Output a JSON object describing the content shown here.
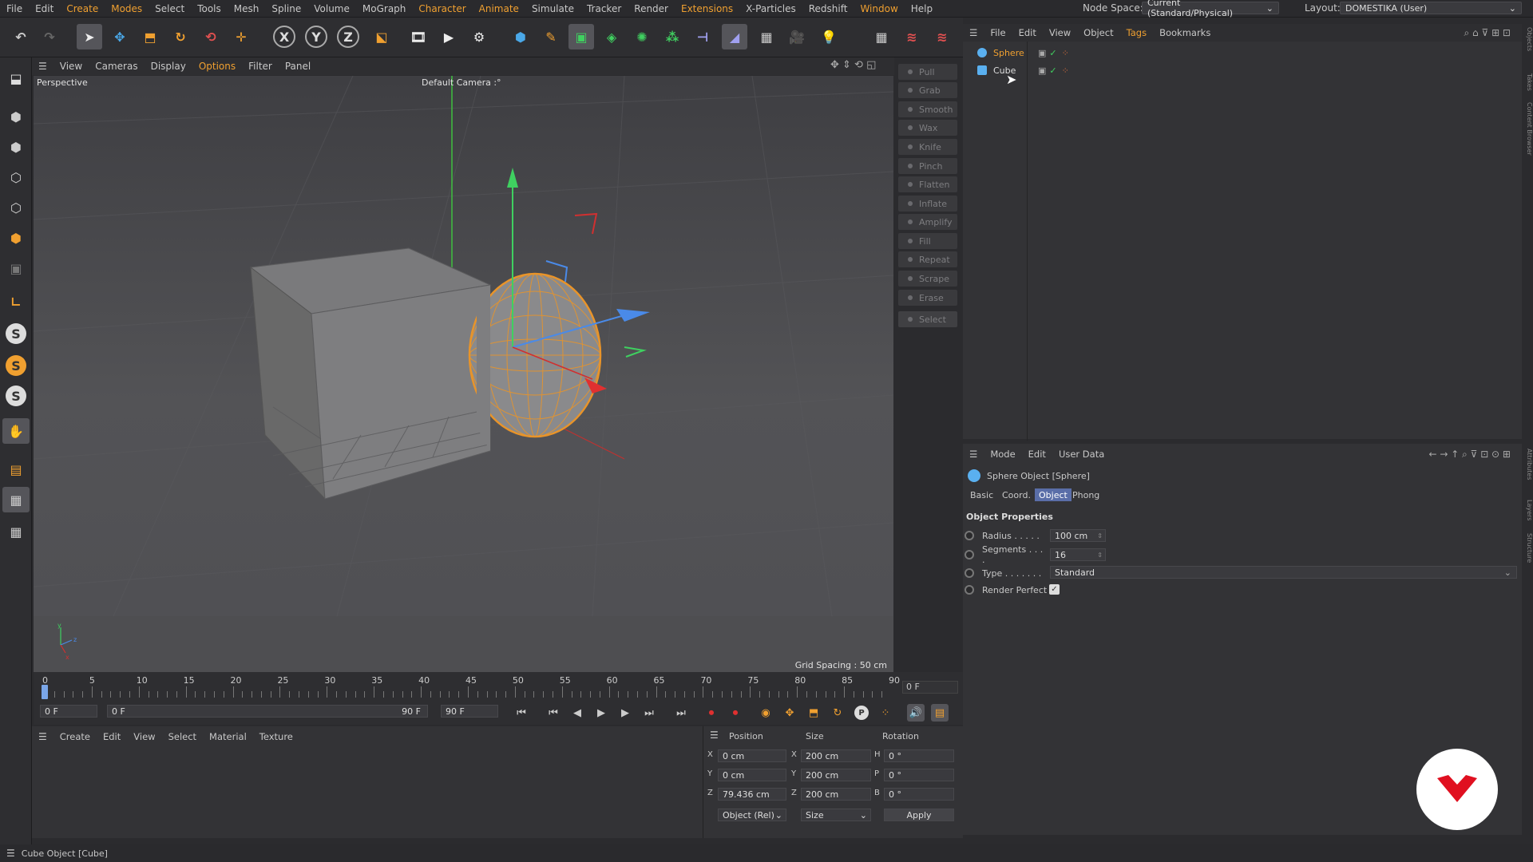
{
  "menubar": {
    "items": [
      "File",
      "Edit",
      "Create",
      "Modes",
      "Select",
      "Tools",
      "Mesh",
      "Spline",
      "Volume",
      "MoGraph",
      "Character",
      "Animate",
      "Simulate",
      "Tracker",
      "Render",
      "Extensions",
      "X-Particles",
      "Redshift",
      "Window",
      "Help"
    ],
    "node_space_label": "Node Space:",
    "node_space_value": "Current (Standard/Physical)",
    "layout_label": "Layout:",
    "layout_value": "DOMESTIKA (User)"
  },
  "viewport": {
    "menu": [
      "View",
      "Cameras",
      "Display",
      "Options",
      "Filter",
      "Panel"
    ],
    "projection": "Perspective",
    "camera": "Default Camera :°",
    "grid_spacing": "Grid Spacing : 50 cm"
  },
  "sculpt": [
    "Pull",
    "Grab",
    "Smooth",
    "Wax",
    "Knife",
    "Pinch",
    "Flatten",
    "Inflate",
    "Amplify",
    "Fill",
    "Repeat",
    "Scrape",
    "Erase",
    "Select"
  ],
  "objects": {
    "menu": [
      "File",
      "Edit",
      "View",
      "Object",
      "Tags",
      "Bookmarks"
    ],
    "items": [
      {
        "name": "Sphere",
        "selected": true
      },
      {
        "name": "Cube",
        "selected": false
      }
    ]
  },
  "attributes": {
    "menu": [
      "Mode",
      "Edit",
      "User Data"
    ],
    "title": "Sphere Object [Sphere]",
    "tabs": [
      "Basic",
      "Coord.",
      "Object",
      "Phong"
    ],
    "active_tab": "Object",
    "section": "Object Properties",
    "radius_label": "Radius . . . . .",
    "radius_value": "100 cm",
    "segments_label": "Segments . . . .",
    "segments_value": "16",
    "type_label": "Type . . . . . . .",
    "type_value": "Standard",
    "render_perfect_label": "Render Perfect",
    "render_perfect": true
  },
  "timeline": {
    "ticks": [
      "0",
      "5",
      "10",
      "15",
      "20",
      "25",
      "30",
      "35",
      "40",
      "45",
      "50",
      "55",
      "60",
      "65",
      "70",
      "75",
      "80",
      "85",
      "90"
    ],
    "current_frame": "0 F",
    "start_frame": "0 F",
    "range_start": "0 F",
    "range_end": "90 F",
    "end_frame": "90 F"
  },
  "material_manager": {
    "menu": [
      "Create",
      "Edit",
      "View",
      "Select",
      "Material",
      "Texture"
    ]
  },
  "coordinates": {
    "headers": [
      "Position",
      "Size",
      "Rotation"
    ],
    "rows": [
      {
        "axis": "X",
        "pos": "0 cm",
        "size_axis": "X",
        "size": "200 cm",
        "rot_axis": "H",
        "rot": "0 °"
      },
      {
        "axis": "Y",
        "pos": "0 cm",
        "size_axis": "Y",
        "size": "200 cm",
        "rot_axis": "P",
        "rot": "0 °"
      },
      {
        "axis": "Z",
        "pos": "79.436 cm",
        "size_axis": "Z",
        "size": "200 cm",
        "rot_axis": "B",
        "rot": "0 °"
      }
    ],
    "mode": "Object (Rel)",
    "size_mode": "Size",
    "apply": "Apply"
  },
  "status": "Cube Object [Cube]",
  "side_tabs": [
    "Objects",
    "Takes",
    "Content Browser",
    "Attributes",
    "Layers",
    "Structure"
  ],
  "colors": {
    "accent": "#f0a030",
    "selected_tab": "#5a6ea8",
    "sphere_wire": "#e8942a",
    "logo": "#e01020"
  }
}
